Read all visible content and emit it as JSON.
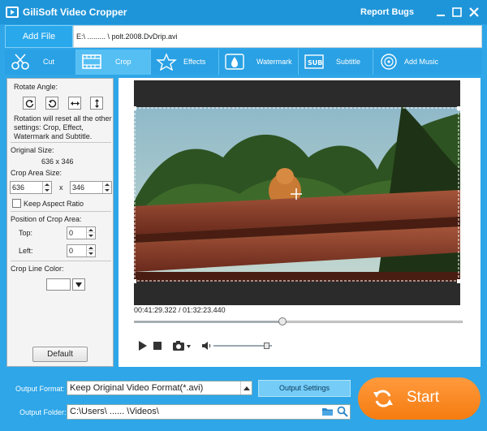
{
  "window": {
    "title": "GiliSoft Video Cropper",
    "report_bugs": "Report Bugs"
  },
  "file": {
    "add_label": "Add File",
    "path": "E:\\   ......... \\   polt.2008.DvDrip.avi"
  },
  "tabs": [
    {
      "label": "Cut",
      "icon": "scissors-icon",
      "active": false
    },
    {
      "label": "Crop",
      "icon": "crop-film-icon",
      "active": true
    },
    {
      "label": "Effects",
      "icon": "effects-star-icon",
      "active": false
    },
    {
      "label": "Watermark",
      "icon": "watermark-drop-icon",
      "active": false
    },
    {
      "label": "Subtitle",
      "icon": "subtitle-film-icon",
      "active": false
    },
    {
      "label": "Add Music",
      "icon": "music-disc-icon",
      "active": false
    }
  ],
  "crop_panel": {
    "rotate_label": "Rotate Angle:",
    "rotation_note_1": "Rotation will reset all the other",
    "rotation_note_2": "settings: Crop, Effect,",
    "rotation_note_3": "Watermark and Subtitle.",
    "original_size_label": "Original Size:",
    "original_size_value": "636 x 346",
    "crop_area_size_label": "Crop Area Size:",
    "crop_width": "636",
    "crop_x": "x",
    "crop_height": "346",
    "keep_aspect_label": "Keep Aspect Ratio",
    "position_label": "Position of Crop Area:",
    "top_label": "Top:",
    "top_value": "0",
    "left_label": "Left:",
    "left_value": "0",
    "line_color_label": "Crop Line Color:",
    "line_color": "#ffffff",
    "default_label": "Default"
  },
  "preview": {
    "time": "00:41:29.322 / 01:32:23.440",
    "progress": 0.449,
    "volume": 0.92
  },
  "output": {
    "format_label": "Output Format:",
    "format_value": "Keep Original Video Format(*.avi)",
    "settings_label": "Output Settings",
    "folder_label": "Output Folder:",
    "folder_value": "C:\\Users\\     ......   \\Videos\\",
    "start_label": "Start"
  },
  "colors": {
    "accent": "#2ea6e8",
    "start": "#f7861c"
  }
}
